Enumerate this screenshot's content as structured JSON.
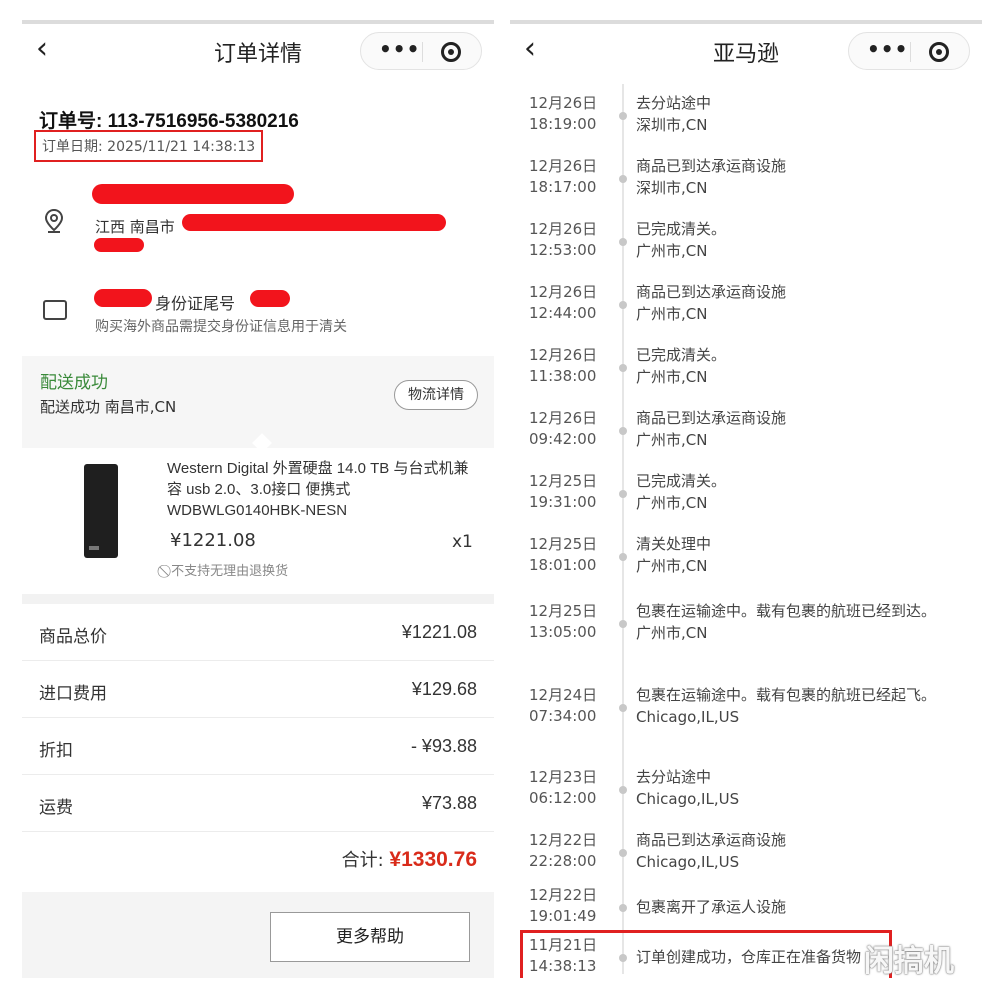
{
  "left": {
    "title": "订单详情",
    "order_no": "订单号: 113-7516956-5380216",
    "order_date": "订单日期: 2025/11/21 14:38:13",
    "address_prefix": "江西 南昌市",
    "id_label": "身份证尾号",
    "id_tip": "购买海外商品需提交身份证信息用于清关",
    "ship_status": "配送成功",
    "ship_sub": "配送成功 南昌市,CN",
    "logistics_button": "物流详情",
    "product_name": "Western Digital 外置硬盘 14.0 TB 与台式机兼容 usb 2.0、3.0接口 便携式 WDBWLG0140HBK-NESN",
    "price": "¥1221.08",
    "qty": "x1",
    "no_return": "不支持无理由退换货",
    "summary": [
      {
        "label": "商品总价",
        "value": "¥1221.08"
      },
      {
        "label": "进口费用",
        "value": "¥129.68"
      },
      {
        "label": "折扣",
        "value": "- ¥93.88"
      },
      {
        "label": "运费",
        "value": "¥73.88"
      }
    ],
    "total_label": "合计:",
    "total_value": "¥1330.76",
    "help_button": "更多帮助"
  },
  "right": {
    "title": "亚马逊",
    "events": [
      {
        "date": "12月26日",
        "time": "18:19:00",
        "desc": "去分站途中",
        "place": "深圳市,CN"
      },
      {
        "date": "12月26日",
        "time": "18:17:00",
        "desc": "商品已到达承运商设施",
        "place": "深圳市,CN"
      },
      {
        "date": "12月26日",
        "time": "12:53:00",
        "desc": "已完成清关。",
        "place": "广州市,CN"
      },
      {
        "date": "12月26日",
        "time": "12:44:00",
        "desc": "商品已到达承运商设施",
        "place": "广州市,CN"
      },
      {
        "date": "12月26日",
        "time": "11:38:00",
        "desc": "已完成清关。",
        "place": "广州市,CN"
      },
      {
        "date": "12月26日",
        "time": "09:42:00",
        "desc": "商品已到达承运商设施",
        "place": "广州市,CN"
      },
      {
        "date": "12月25日",
        "time": "19:31:00",
        "desc": "已完成清关。",
        "place": "广州市,CN"
      },
      {
        "date": "12月25日",
        "time": "18:01:00",
        "desc": "清关处理中",
        "place": "广州市,CN"
      },
      {
        "date": "12月25日",
        "time": "13:05:00",
        "desc": "包裹在运输途中。载有包裹的航班已经到达。",
        "place": "广州市,CN"
      },
      {
        "date": "12月24日",
        "time": "07:34:00",
        "desc": "包裹在运输途中。载有包裹的航班已经起飞。",
        "place": "Chicago,IL,US"
      },
      {
        "date": "12月23日",
        "time": "06:12:00",
        "desc": "去分站途中",
        "place": "Chicago,IL,US"
      },
      {
        "date": "12月22日",
        "time": "22:28:00",
        "desc": "商品已到达承运商设施",
        "place": "Chicago,IL,US"
      },
      {
        "date": "12月22日",
        "time": "19:01:49",
        "desc": "包裹离开了承运人设施",
        "place": ""
      },
      {
        "date": "11月21日",
        "time": "14:38:13",
        "desc": "订单创建成功，仓库正在准备货物",
        "place": ""
      }
    ]
  },
  "watermark": "闲搞机",
  "colors": {
    "accent_red": "#e02020",
    "price_red": "#d92b1a",
    "status_green": "#3a8a3a"
  }
}
